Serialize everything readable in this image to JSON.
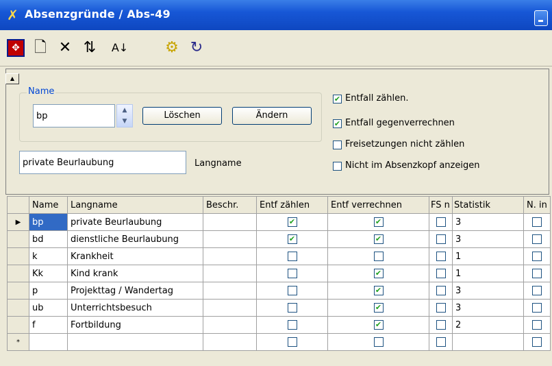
{
  "window": {
    "title": "Absenzgründe / Abs-49",
    "minimize_label": "_"
  },
  "toolbar": {
    "icons": [
      "target-icon",
      "new-document-icon",
      "delete-icon",
      "replace-icon",
      "sort-az-icon",
      "gears-icon",
      "refresh-icon"
    ],
    "glyphs": {
      "target": "✥",
      "new": "🗋",
      "delete": "✕",
      "replace": "⇅",
      "sort": "A↓",
      "gears": "⚙",
      "refresh": "↻"
    }
  },
  "form": {
    "name_group_label": "Name",
    "name_value": "bp",
    "delete_button": "Löschen",
    "change_button": "Ändern",
    "langname_value": "private Beurlaubung",
    "langname_label": "Langname",
    "options": [
      {
        "label": "Entfall zählen.",
        "checked": true
      },
      {
        "label": "Entfall gegenverrechnen",
        "checked": true
      },
      {
        "label": "Freisetzungen nicht zählen",
        "checked": false
      },
      {
        "label": "Nicht im Absenzkopf anzeigen",
        "checked": false
      }
    ]
  },
  "grid": {
    "columns": [
      "Name",
      "Langname",
      "Beschr.",
      "Entf zählen",
      "Entf verrechnen",
      "FS n",
      "Statistik",
      "N. in"
    ],
    "rows": [
      {
        "name": "bp",
        "langname": "private Beurlaubung",
        "beschr": "",
        "entf_zaehlen": true,
        "entf_verrechnen": true,
        "fs_n": false,
        "statistik": "3",
        "n_in": false
      },
      {
        "name": "bd",
        "langname": "dienstliche Beurlaubung",
        "beschr": "",
        "entf_zaehlen": true,
        "entf_verrechnen": true,
        "fs_n": false,
        "statistik": "3",
        "n_in": false
      },
      {
        "name": "k",
        "langname": "Krankheit",
        "beschr": "",
        "entf_zaehlen": false,
        "entf_verrechnen": false,
        "fs_n": false,
        "statistik": "1",
        "n_in": false
      },
      {
        "name": "Kk",
        "langname": "Kind krank",
        "beschr": "",
        "entf_zaehlen": false,
        "entf_verrechnen": true,
        "fs_n": false,
        "statistik": "1",
        "n_in": false
      },
      {
        "name": "p",
        "langname": "Projekttag / Wandertag",
        "beschr": "",
        "entf_zaehlen": false,
        "entf_verrechnen": true,
        "fs_n": false,
        "statistik": "3",
        "n_in": false
      },
      {
        "name": "ub",
        "langname": "Unterrichtsbesuch",
        "beschr": "",
        "entf_zaehlen": false,
        "entf_verrechnen": true,
        "fs_n": false,
        "statistik": "3",
        "n_in": false
      },
      {
        "name": "f",
        "langname": "Fortbildung",
        "beschr": "",
        "entf_zaehlen": false,
        "entf_verrechnen": true,
        "fs_n": false,
        "statistik": "2",
        "n_in": false
      }
    ],
    "current_row_marker": "▶",
    "new_row_marker": "*"
  }
}
